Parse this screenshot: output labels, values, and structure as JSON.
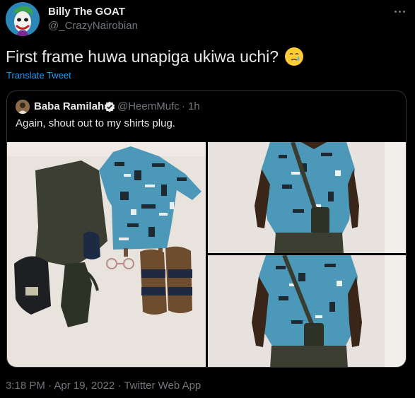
{
  "tweet": {
    "author_name": "Billy The GOAT",
    "author_handle": "@_CrazyNairobian",
    "text": "First frame huwa unapiga ukiwa uchi?",
    "emoji": "face-holding-back-tears",
    "translate_label": "Translate Tweet",
    "timestamp": "3:18 PM · Apr 19, 2022 · Twitter Web App"
  },
  "quoted": {
    "author_name": "Baba Ramilah",
    "author_handle": "@HeemMufc",
    "separator": "·",
    "time": "1h",
    "text": "Again, shout out to my shirts plug.",
    "verified": true
  },
  "colors": {
    "background": "#000000",
    "text": "#e7e9ea",
    "muted": "#71767b",
    "link": "#1d9bf0",
    "border": "#2f3336"
  }
}
